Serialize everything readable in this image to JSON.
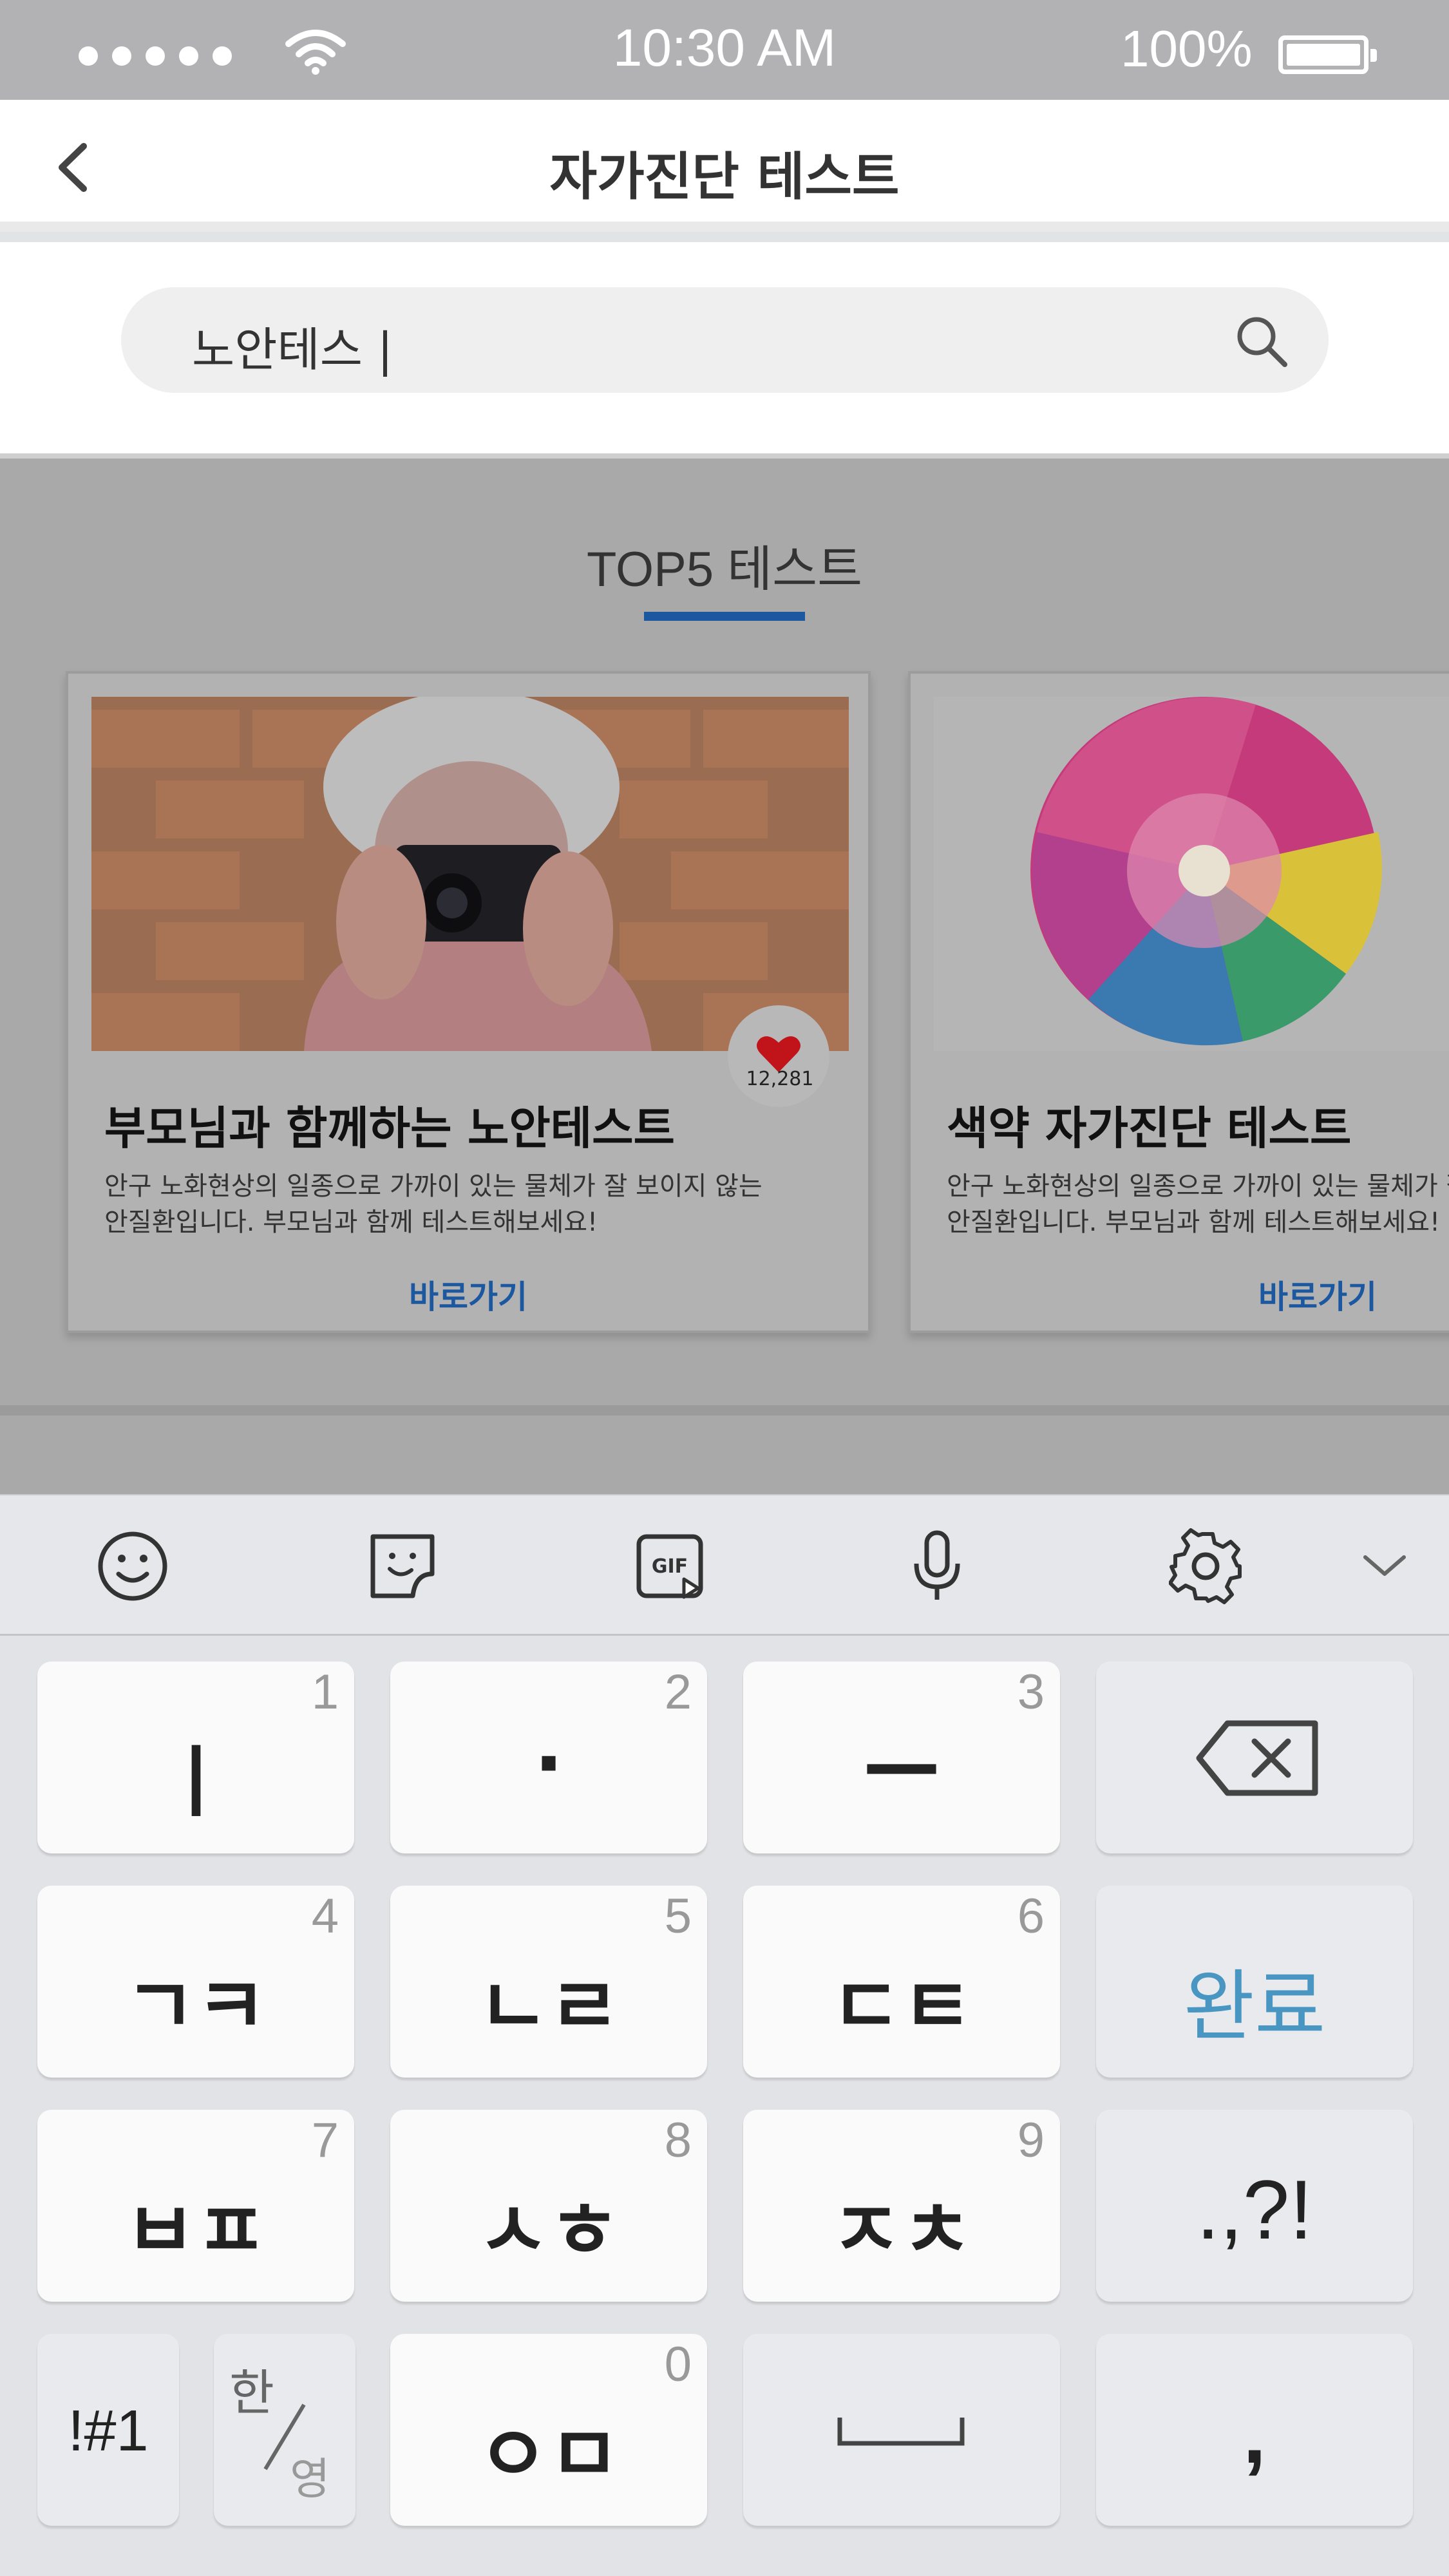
{
  "status": {
    "time": "10:30 AM",
    "battery": "100%"
  },
  "header": {
    "title": "자가진단 테스트"
  },
  "search": {
    "value": "노안테스 |"
  },
  "section": {
    "title": "TOP5 테스트"
  },
  "cards": [
    {
      "likes": "12,281",
      "title": "부모님과 함께하는 노안테스트",
      "desc1": "안구 노화현상의 일종으로 가까이 있는 물체가 잘 보이지 않는",
      "desc2": "안질환입니다. 부모님과 함께 테스트해보세요!",
      "link": "바로가기"
    },
    {
      "title": "색약 자가진단 테스트",
      "desc1": "안구 노화현상의 일종으로 가까이 있는 물체가 잘",
      "desc2": "안질환입니다. 부모님과 함께 테스트해보세요!",
      "link": "바로가기"
    }
  ],
  "keyboard": {
    "toolbar_icons": [
      "emoji-icon",
      "sticker-icon",
      "gif-icon",
      "microphone-icon",
      "settings-icon",
      "chevron-down-icon"
    ],
    "gif": "GIF",
    "keys": {
      "k1": {
        "num": "1",
        "label": "ㅣ"
      },
      "k2": {
        "num": "2",
        "label": "·"
      },
      "k3": {
        "num": "3",
        "label": "—"
      },
      "k4": {
        "num": "4",
        "label": "ㄱㅋ"
      },
      "k5": {
        "num": "5",
        "label": "ㄴㄹ"
      },
      "k6": {
        "num": "6",
        "label": "ㄷㅌ"
      },
      "k7": {
        "num": "7",
        "label": "ㅂㅍ"
      },
      "k8": {
        "num": "8",
        "label": "ㅅㅎ"
      },
      "k9": {
        "num": "9",
        "label": "ㅈㅊ"
      },
      "k0": {
        "num": "0",
        "label": "ㅇㅁ"
      },
      "done": "완료",
      "punct": ".,?!",
      "symbols": "!#1",
      "lang_han": "한",
      "lang_eng": "영",
      "comma": ","
    }
  }
}
